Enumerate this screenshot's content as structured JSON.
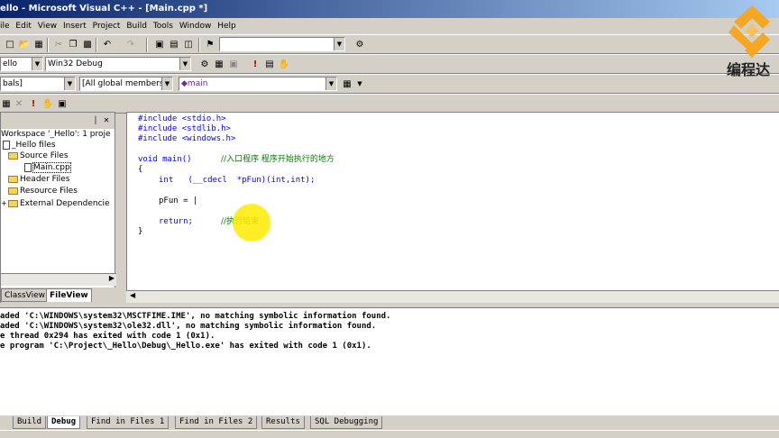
{
  "window": {
    "title": "ello - Microsoft Visual C++ - [Main.cpp *]"
  },
  "menu": [
    "ile",
    "Edit",
    "View",
    "Insert",
    "Project",
    "Build",
    "Tools",
    "Window",
    "Help"
  ],
  "toolbar": {
    "find_combo_value": "",
    "project_combo": "ello",
    "config_combo": "Win32 Debug",
    "scope_combo": "bals]",
    "members_combo": "[All global members",
    "function_combo": "◆main"
  },
  "logo": {
    "text": "编程达"
  },
  "workspace": {
    "tree": [
      {
        "label": "Workspace '_Hello': 1 proje",
        "type": "root"
      },
      {
        "label": "_Hello files",
        "type": "project"
      },
      {
        "label": "Source Files",
        "type": "folder"
      },
      {
        "label": "Main.cpp",
        "type": "file"
      },
      {
        "label": "Header Files",
        "type": "folder"
      },
      {
        "label": "Resource Files",
        "type": "folder"
      },
      {
        "label": "External Dependencie",
        "type": "folder"
      }
    ],
    "tabs": [
      "ClassView",
      "FileView"
    ]
  },
  "editor": {
    "lines": [
      {
        "text": "#include <stdio.h>",
        "kind": "kw"
      },
      {
        "text": "#include <stdlib.h>",
        "kind": "kw"
      },
      {
        "text": "#include <windows.h>",
        "kind": "kw"
      },
      {
        "text": "",
        "kind": "plain"
      },
      {
        "code": "void main()",
        "comment": "//入口程序 程序开始执行的地方"
      },
      {
        "text": "{",
        "kind": "plain"
      },
      {
        "code": "int   (__cdecl  *pFun)(int,int);",
        "indent": true
      },
      {
        "text": "",
        "kind": "plain"
      },
      {
        "code": "pFun = |",
        "indent": true
      },
      {
        "text": "",
        "kind": "plain"
      },
      {
        "code": "return;",
        "comment": "//执行结束",
        "indent": true
      },
      {
        "text": "}",
        "kind": "plain"
      }
    ]
  },
  "output": {
    "lines": [
      "aded 'C:\\WINDOWS\\system32\\MSCTFIME.IME', no matching symbolic information found.",
      "aded 'C:\\WINDOWS\\system32\\ole32.dll', no matching symbolic information found.",
      "e thread 0x294 has exited with code 1 (0x1).",
      "e program 'C:\\Project\\_Hello\\Debug\\_Hello.exe' has exited with code 1 (0x1)."
    ],
    "tabs": [
      "Build",
      "Debug",
      "Find in Files 1",
      "Find in Files 2",
      "Results",
      "SQL Debugging"
    ],
    "active_tab": "Debug"
  }
}
